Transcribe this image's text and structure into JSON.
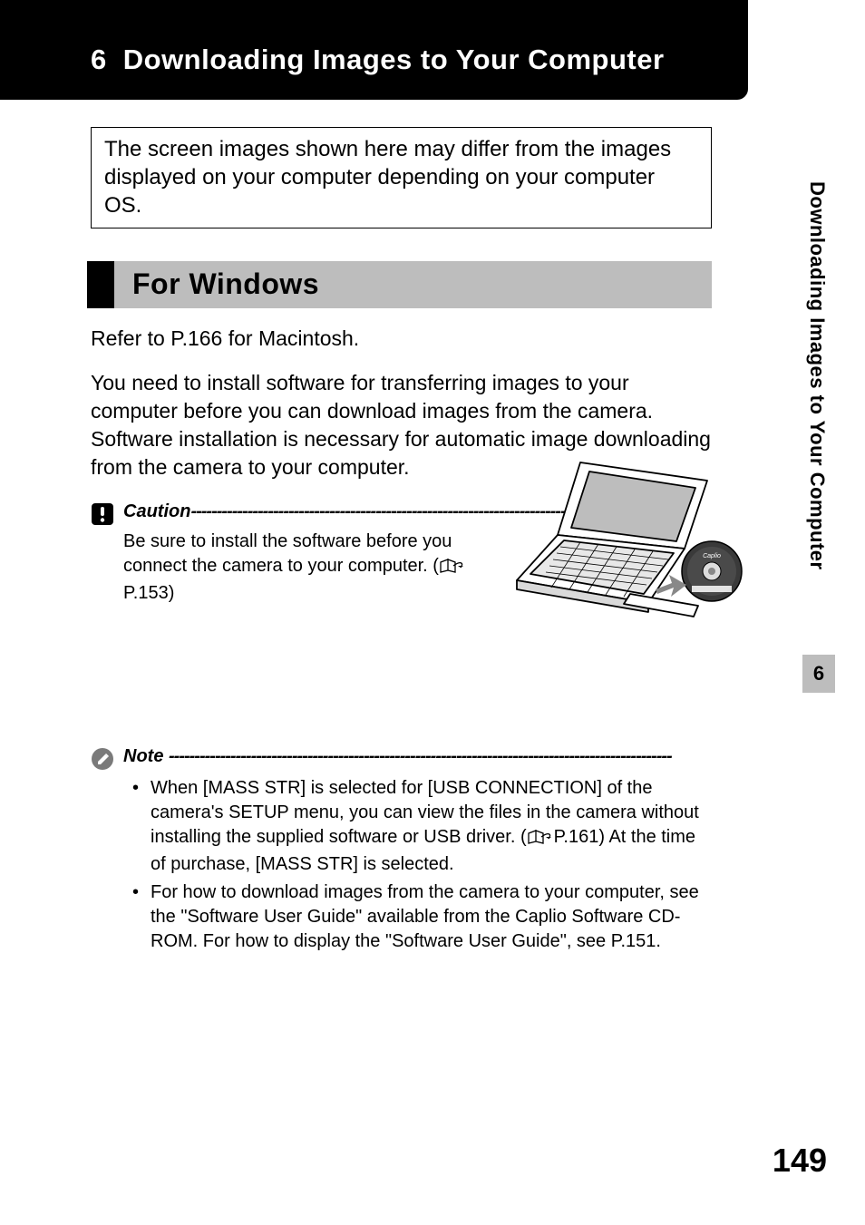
{
  "chapter": {
    "number": "6",
    "title": "Downloading Images to Your Computer"
  },
  "notice": "The screen images shown here may differ from the images displayed on your computer depending on your computer OS.",
  "section": {
    "title": "For Windows"
  },
  "paragraphs": {
    "refer_mac": "Refer to P.166 for Macintosh.",
    "intro": "You need to install software for transferring images to your computer before you can download images from the camera. Software installation is necessary for automatic image downloading from the camera to your computer."
  },
  "caution": {
    "label": "Caution",
    "dashes": "---------------------------------------------------------------------------------------------",
    "body_1": "Be sure to install the software before you connect the camera to your computer. (",
    "page_ref": "P.153)",
    "icon_name": "caution-exclamation-icon"
  },
  "note": {
    "label": "Note ",
    "dashes": "--------------------------------------------------------------------------------------------------",
    "icon_name": "note-pencil-icon",
    "items": [
      {
        "part1": "When [MASS STR] is selected for [USB CONNECTION] of the camera's SETUP menu, you can view the files in the camera without installing the supplied software or USB driver. (",
        "page_ref": "P.161) At the time of purchase, [MASS STR] is selected."
      },
      {
        "part1": "For how to download images from the camera to your computer, see the \"Software User Guide\" available from the Caplio Software CD-ROM. For how to display the \"Software User Guide\", see P.151.",
        "page_ref": ""
      }
    ]
  },
  "side_tab": {
    "text": "Downloading Images to Your Computer",
    "chapter": "6"
  },
  "page_number": "149"
}
